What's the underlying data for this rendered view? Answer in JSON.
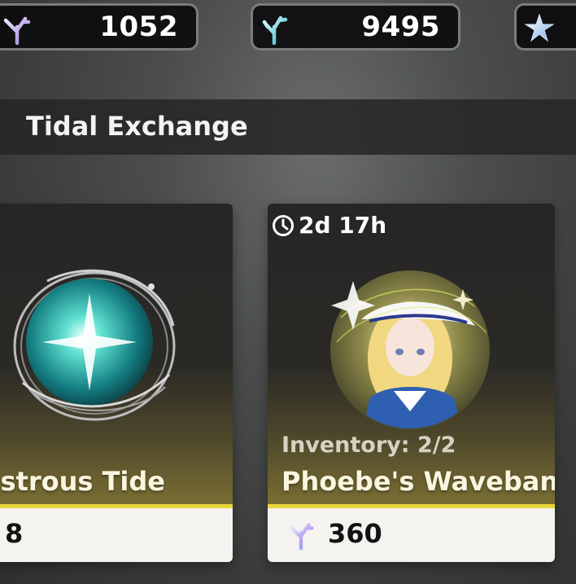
{
  "currencies": [
    {
      "icon": "coral-icon",
      "amount": "1052"
    },
    {
      "icon": "coral-icon",
      "amount": "9495"
    },
    {
      "icon": "star-crystal-icon",
      "amount": ""
    }
  ],
  "header": {
    "title": "Tidal Exchange"
  },
  "items": [
    {
      "name": "strous Tide",
      "price": "8",
      "image": "lustrous-tide-orb"
    },
    {
      "name": "Phoebe's Waveband",
      "price": "360",
      "inventory": "Inventory: 2/2",
      "timer": "2d 17h",
      "image": "phoebe-waveband-portrait"
    }
  ],
  "colors": {
    "accent_bar": "#e9d63b",
    "card_gold": "#a08f3a",
    "price_bg": "#f4f3ef"
  }
}
